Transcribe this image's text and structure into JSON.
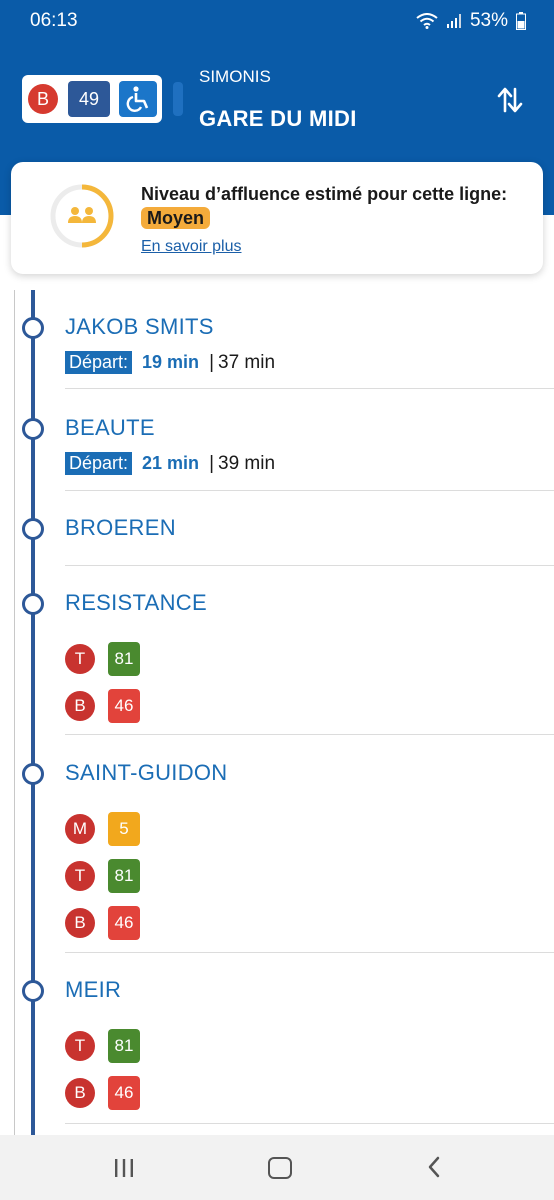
{
  "status_bar": {
    "time": "06:13",
    "battery": "53%",
    "icons": [
      "wifi-icon",
      "signal-icon",
      "battery-icon"
    ]
  },
  "header": {
    "mode": "B",
    "line_number": "49",
    "accessibility_icon": "wheelchair-icon",
    "from_stop": "SIMONIS",
    "to_stop": "GARE DU MIDI",
    "swap_icon": "swap-direction-icon"
  },
  "crowd": {
    "title": "Niveau d’affluence estimé pour cette ligne:",
    "level": "Moyen",
    "link": "En savoir plus",
    "gauge_fraction": 0.5,
    "icon": "people-icon"
  },
  "stops": [
    {
      "name": "JAKOB SMITS",
      "depart_label": "Départ:",
      "first": "19 min",
      "second": "37 min",
      "connections": []
    },
    {
      "name": "BEAUTE",
      "depart_label": "Départ:",
      "first": "21 min",
      "second": "39 min",
      "connections": []
    },
    {
      "name": "BROEREN",
      "connections": []
    },
    {
      "name": "RESISTANCE",
      "connections": [
        {
          "mode": "T",
          "line": "81",
          "color": "#4a8a2f"
        },
        {
          "mode": "B",
          "line": "46",
          "color": "#e2433b"
        }
      ]
    },
    {
      "name": "SAINT-GUIDON",
      "connections": [
        {
          "mode": "M",
          "line": "5",
          "color": "#f2a81d"
        },
        {
          "mode": "T",
          "line": "81",
          "color": "#4a8a2f"
        },
        {
          "mode": "B",
          "line": "46",
          "color": "#e2433b"
        }
      ]
    },
    {
      "name": "MEIR",
      "connections": [
        {
          "mode": "T",
          "line": "81",
          "color": "#4a8a2f"
        },
        {
          "mode": "B",
          "line": "46",
          "color": "#e2433b"
        }
      ]
    }
  ],
  "colors": {
    "header_blue": "#0a5ba8",
    "route_line": "#2d5898",
    "stop_text": "#1b6db5",
    "crowd_moyen": "#f4ab3b"
  },
  "nav": {
    "recent_icon": "recent-apps-icon",
    "home_icon": "home-icon",
    "back_icon": "back-icon"
  }
}
